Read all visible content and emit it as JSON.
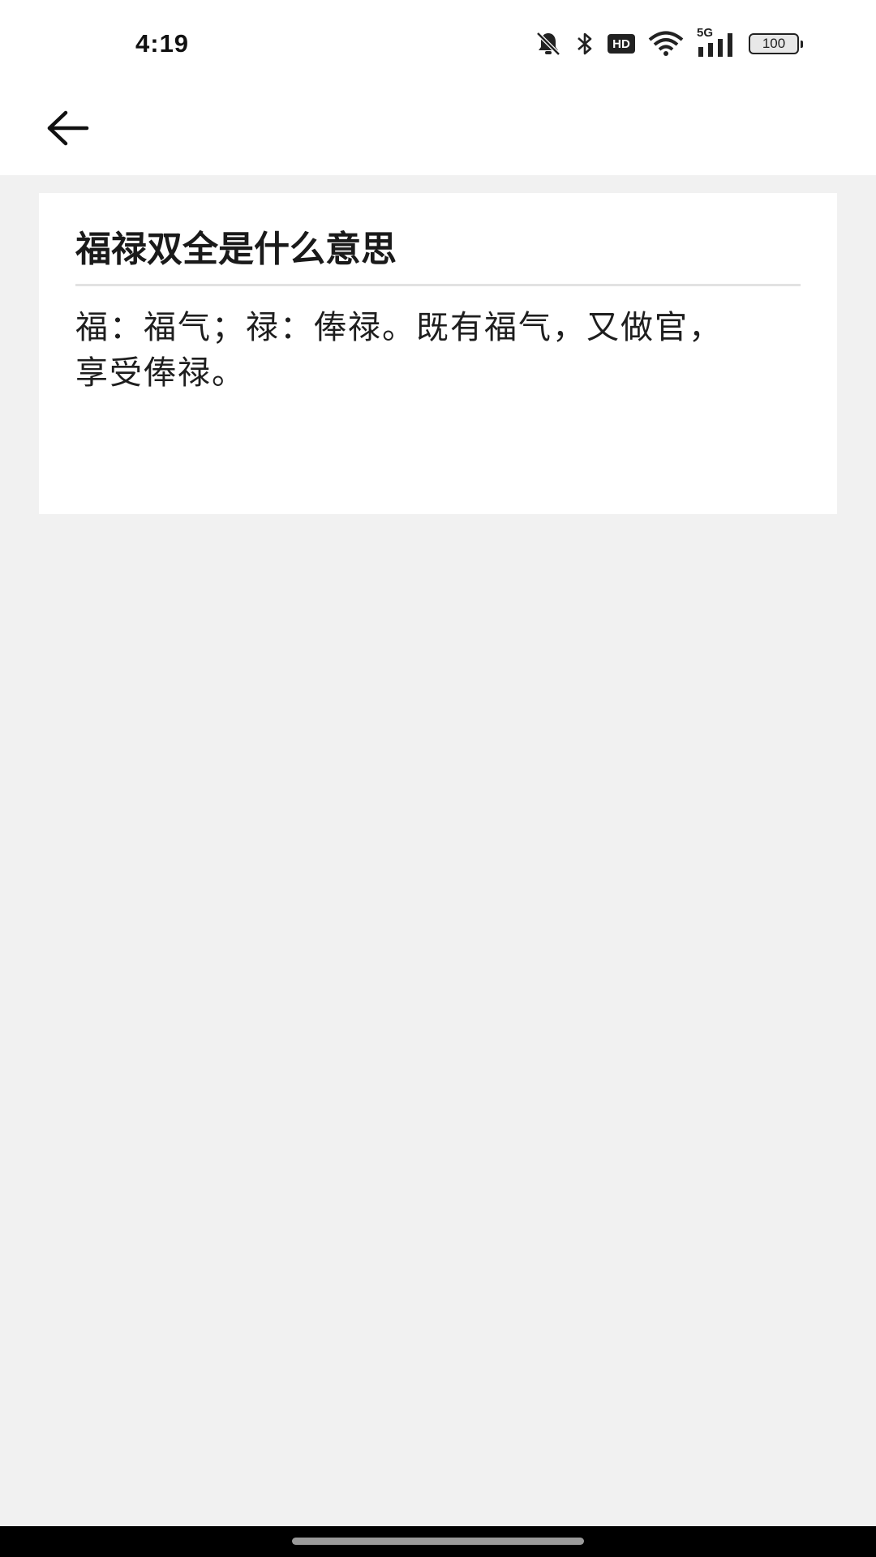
{
  "status_bar": {
    "time": "4:19",
    "network_label": "5G",
    "hd_label": "HD",
    "battery_level": "100",
    "icons": [
      "bell-off-icon",
      "bluetooth-icon",
      "hd-icon",
      "wifi-icon",
      "signal-icon",
      "battery-icon"
    ]
  },
  "app_bar": {
    "back_icon": "arrow-left-icon"
  },
  "card": {
    "title": "福禄双全是什么意思",
    "body": "福：福气；禄：俸禄。既有福气，又做官，享受俸禄。"
  }
}
